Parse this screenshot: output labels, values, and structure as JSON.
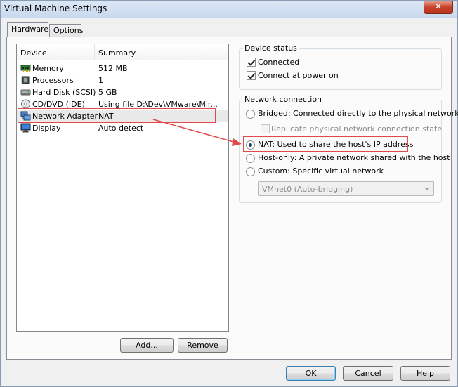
{
  "window": {
    "title": "Virtual Machine Settings",
    "close_label": "✕"
  },
  "tabs": [
    {
      "label": "Hardware",
      "active": true
    },
    {
      "label": "Options",
      "active": false
    }
  ],
  "device_list": {
    "columns": [
      "Device",
      "Summary"
    ],
    "rows": [
      {
        "device": "Memory",
        "summary": "512 MB",
        "icon": "memory-icon"
      },
      {
        "device": "Processors",
        "summary": "1",
        "icon": "processor-icon"
      },
      {
        "device": "Hard Disk (SCSI)",
        "summary": "5 GB",
        "icon": "hard-disk-icon"
      },
      {
        "device": "CD/DVD (IDE)",
        "summary": "Using file D:\\Dev\\VMware\\Mir...",
        "icon": "cd-dvd-icon"
      },
      {
        "device": "Network Adapter",
        "summary": "NAT",
        "icon": "network-adapter-icon",
        "selected": true
      },
      {
        "device": "Display",
        "summary": "Auto detect",
        "icon": "display-icon"
      }
    ]
  },
  "list_buttons": {
    "add": "Add...",
    "remove": "Remove"
  },
  "device_status": {
    "title": "Device status",
    "connected": {
      "label": "Connected",
      "checked": true
    },
    "connect_at_power_on": {
      "label": "Connect at power on",
      "checked": true
    }
  },
  "network_connection": {
    "title": "Network connection",
    "bridged": {
      "label": "Bridged: Connected directly to the physical network",
      "selected": false
    },
    "replicate": {
      "label": "Replicate physical network connection state",
      "checked": false,
      "enabled": false
    },
    "nat": {
      "label": "NAT: Used to share the host's IP address",
      "selected": true
    },
    "host_only": {
      "label": "Host-only: A private network shared with the host",
      "selected": false
    },
    "custom": {
      "label": "Custom: Specific virtual network",
      "selected": false
    },
    "vmnet_select": {
      "value": "VMnet0 (Auto-bridging)",
      "enabled": false
    }
  },
  "dialog_buttons": {
    "ok": "OK",
    "cancel": "Cancel",
    "help": "Help"
  },
  "annotation_color": "#e04a4a"
}
